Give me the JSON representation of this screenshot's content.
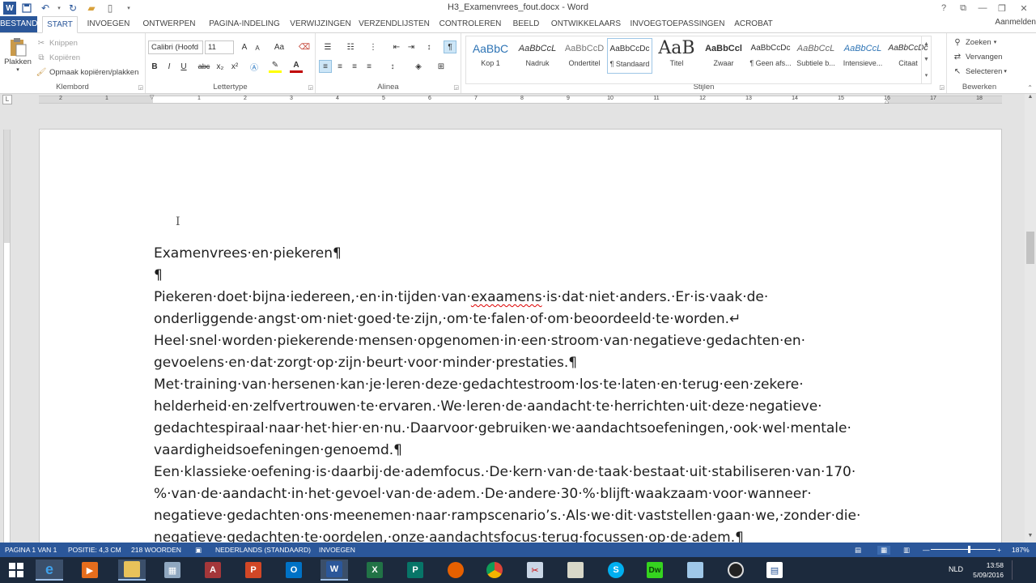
{
  "window": {
    "title": "H3_Examenvrees_fout.docx - Word",
    "controls": {
      "help": "?",
      "ribbon_display": "⧉",
      "minimize": "—",
      "restore": "❐",
      "close": "✕"
    }
  },
  "tabs": [
    "BESTAND",
    "START",
    "INVOEGEN",
    "ONTWERPEN",
    "PAGINA-INDELING",
    "VERWIJZINGEN",
    "VERZENDLIJSTEN",
    "CONTROLEREN",
    "BEELD",
    "ONTWIKKELAARS",
    "INVOEGTOEPASSINGEN",
    "ACROBAT"
  ],
  "active_tab": "START",
  "signin": "Aanmelden",
  "ribbon": {
    "clipboard": {
      "label": "Klembord",
      "paste": "Plakken",
      "cut": "Knippen",
      "copy": "Kopiëren",
      "format_painter": "Opmaak kopiëren/plakken"
    },
    "font": {
      "label": "Lettertype",
      "font_name": "Calibri (Hoofd",
      "font_size": "11",
      "grow": "A",
      "shrink": "A",
      "case": "Aa",
      "bold": "B",
      "italic": "I",
      "underline": "U",
      "strike": "abc",
      "sub": "x₂",
      "sup": "x²"
    },
    "paragraph": {
      "label": "Alinea"
    },
    "styles": {
      "label": "Stijlen",
      "items": [
        {
          "sample": "AaBbC",
          "name": "Kop 1"
        },
        {
          "sample": "AaBbCcL",
          "name": "Nadruk"
        },
        {
          "sample": "AaBbCcD",
          "name": "Ondertitel"
        },
        {
          "sample": "AaBbCcDc",
          "name": "¶ Standaard"
        },
        {
          "sample": "AaB",
          "name": "Titel"
        },
        {
          "sample": "AaBbCcl",
          "name": "Zwaar"
        },
        {
          "sample": "AaBbCcDc",
          "name": "¶ Geen afs..."
        },
        {
          "sample": "AaBbCcL",
          "name": "Subtiele b..."
        },
        {
          "sample": "AaBbCcL",
          "name": "Intensieve..."
        },
        {
          "sample": "AaBbCcDc",
          "name": "Citaat"
        }
      ],
      "selected_index": 3
    },
    "editing": {
      "label": "Bewerken",
      "find": "Zoeken",
      "replace": "Vervangen",
      "select": "Selecteren"
    }
  },
  "ruler": {
    "numbers": [
      "2",
      "1",
      "1",
      "2",
      "3",
      "4",
      "5",
      "6",
      "7",
      "8",
      "9",
      "10",
      "11",
      "12",
      "13",
      "14",
      "15",
      "16",
      "17",
      "18"
    ]
  },
  "document": {
    "lines": [
      "Examenvrees·en·piekeren¶",
      "¶",
      "Piekeren·doet·bijna·iedereen,·en·in·tijden·van·",
      "·is·dat·niet·anders.·Er·is·vaak·de·",
      "onderliggende·angst·om·niet·goed·te·zijn,·om·te·falen·of·om·beoordeeld·te·worden.↵",
      "Heel·snel·worden·piekerende·mensen·opgenomen·in·een·stroom·van·negatieve·gedachten·en·",
      "gevoelens·en·dat·zorgt·op·zijn·beurt·voor·minder·prestaties.¶",
      "Met·training·van·hersenen·kan·je·leren·deze·gedachtestroom·los·te·laten·en·terug·een·zekere·",
      "helderheid·en·zelfvertrouwen·te·ervaren.·We·leren·de·aandacht·te·herrichten·uit·deze·negatieve·",
      "gedachtespiraal·naar·het·hier·en·nu.·Daarvoor·gebruiken·we·aandachtsoefeningen,·ook·wel·mentale·",
      "vaardigheidsoefeningen·genoemd.¶",
      "Een·klassieke·oefening·is·daarbij·de·ademfocus.·De·kern·van·de·taak·bestaat·uit·stabiliseren·van·170·",
      "%·van·de·aandacht·in·het·gevoel·van·de·adem.·De·andere·30·%·blijft·waakzaam·voor·wanneer·",
      "negatieve·gedachten·ons·meenemen·naar·rampscenario’s.·Als·we·dit·vaststellen·gaan·we,·zonder·die·",
      "negatieve·gedachten·te·oordelen,·onze·aandachtsfocus·terug·focussen·op·de·adem.¶"
    ],
    "misspelled": "exaamens"
  },
  "statusbar": {
    "page": "PAGINA 1 VAN 1",
    "position": "POSITIE: 4,3 CM",
    "words": "218 WOORDEN",
    "language": "NEDERLANDS (STANDAARD)",
    "mode": "INVOEGEN",
    "zoom": "187%",
    "zoom_level_percent": 187
  },
  "taskbar": {
    "lang": "NLD",
    "time": "13:58",
    "date": "5/09/2016",
    "apps": [
      "windows",
      "internet-explorer",
      "media-player",
      "file-explorer",
      "calculator",
      "access",
      "powerpoint",
      "outlook",
      "word",
      "excel",
      "publisher",
      "firefox",
      "chrome",
      "snipping-tool",
      "scanner",
      "skype",
      "dreamweaver",
      "notes",
      "obs",
      "document"
    ]
  },
  "colors": {
    "word_blue": "#2b579a",
    "taskbar": "#1c2a3d"
  }
}
